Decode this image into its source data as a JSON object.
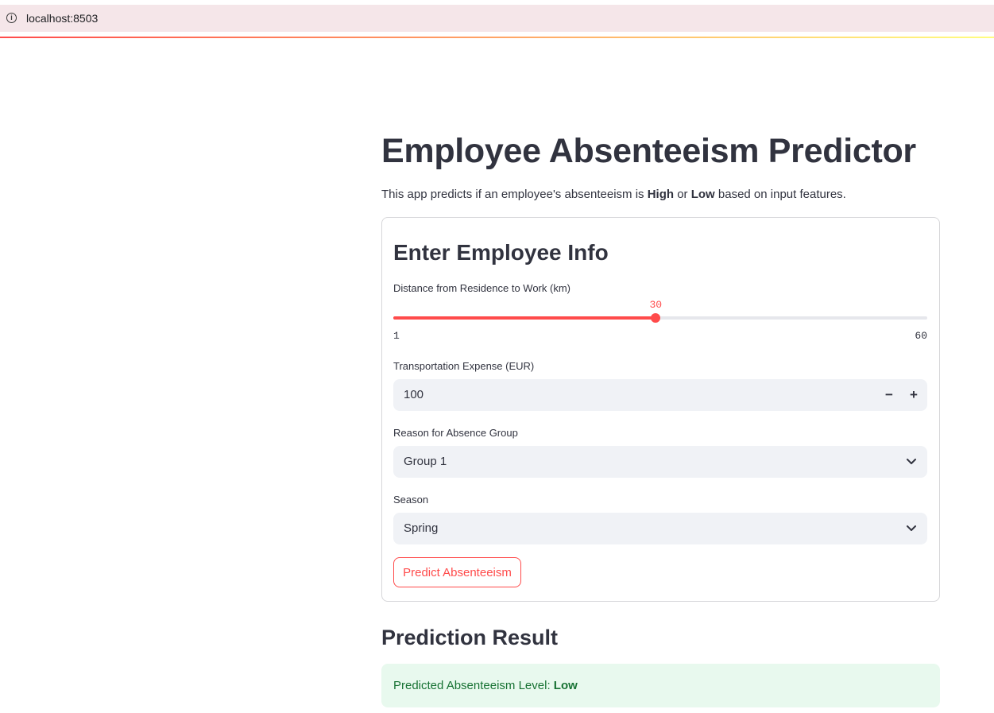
{
  "browser": {
    "url": "localhost:8503"
  },
  "app": {
    "title": "Employee Absenteeism Predictor",
    "intro": {
      "prefix": "This app predicts if an employee's absenteeism is ",
      "high": "High",
      "or": " or ",
      "low": "Low",
      "suffix": " based on input features."
    }
  },
  "form": {
    "title": "Enter Employee Info",
    "distance": {
      "label": "Distance from Residence to Work (km)",
      "value": 30,
      "min": 1,
      "max": 60
    },
    "expense": {
      "label": "Transportation Expense (EUR)",
      "value": "100",
      "minus": "−",
      "plus": "+"
    },
    "reason": {
      "label": "Reason for Absence Group",
      "selected": "Group 1"
    },
    "season": {
      "label": "Season",
      "selected": "Spring"
    },
    "submit_label": "Predict Absenteeism"
  },
  "result": {
    "title": "Prediction Result",
    "prefix": "Predicted Absenteeism Level: ",
    "level": "Low"
  },
  "colors": {
    "accent": "#ff4b4b",
    "success_bg": "#e8f9ee",
    "success_text": "#177233"
  }
}
